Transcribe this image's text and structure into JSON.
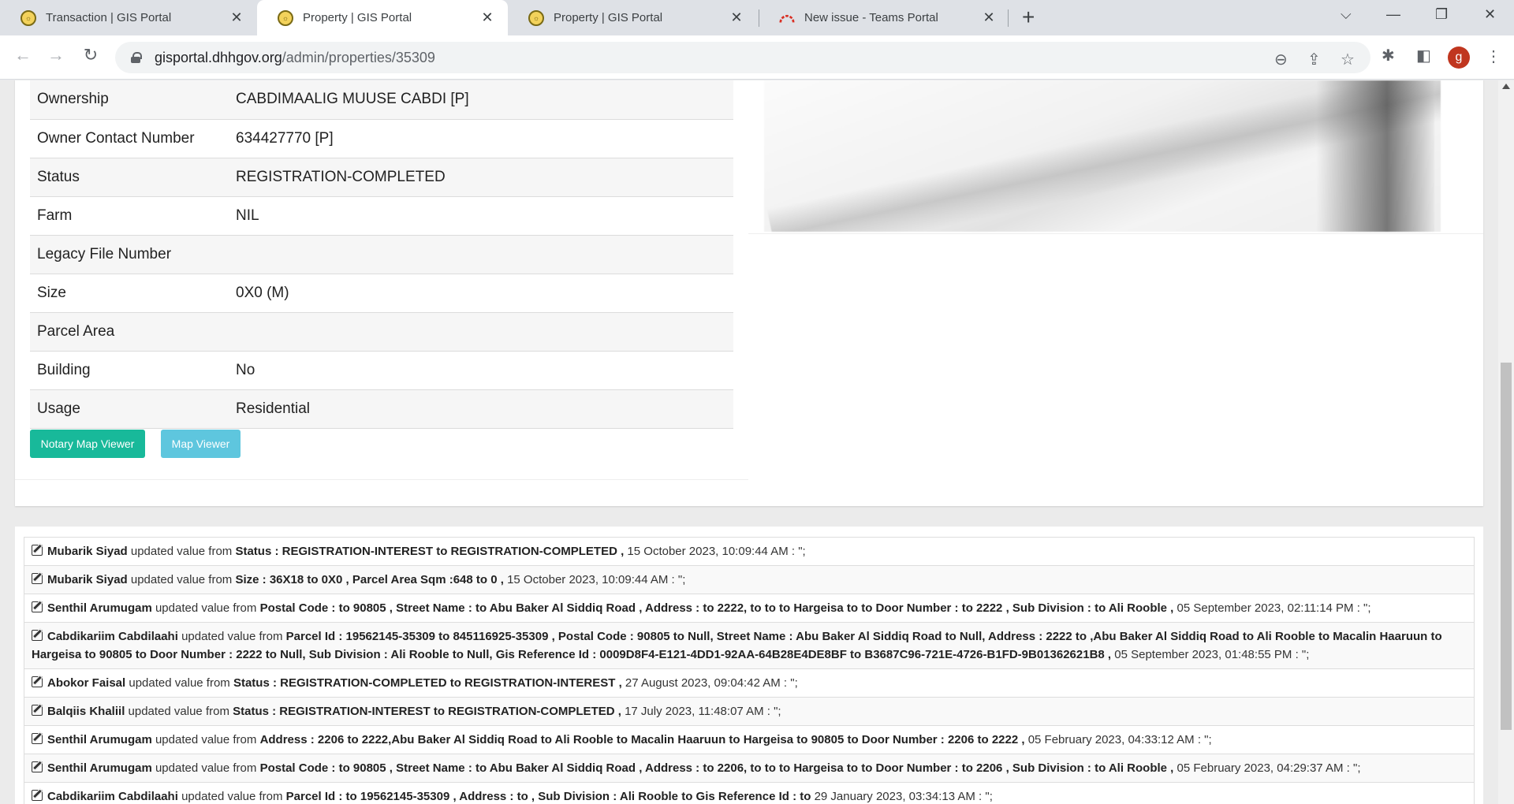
{
  "browser": {
    "tabs": [
      {
        "title": "Transaction | GIS Portal",
        "active": false,
        "favicon": "gis-seal-icon"
      },
      {
        "title": "Property | GIS Portal",
        "active": true,
        "favicon": "gis-seal-icon"
      },
      {
        "title": "Property | GIS Portal",
        "active": false,
        "favicon": "gis-seal-icon"
      },
      {
        "title": "New issue - Teams Portal",
        "active": false,
        "favicon": "teams-logo-icon"
      }
    ],
    "new_tab_glyph": "+",
    "close_glyph": "✕",
    "url_host": "gisportal.dhhgov.org",
    "url_path": "/admin/properties/35309",
    "profile_initial": "g",
    "profile_color": "#c0361f"
  },
  "property": {
    "rows": [
      {
        "label": "Ownership",
        "value": "CABDIMAALIG MUUSE CABDI [P]"
      },
      {
        "label": "Owner Contact Number",
        "value": "634427770 [P]"
      },
      {
        "label": "Status",
        "value": "REGISTRATION-COMPLETED"
      },
      {
        "label": "Farm",
        "value": "NIL"
      },
      {
        "label": "Legacy File Number",
        "value": ""
      },
      {
        "label": "Size",
        "value": "0X0 (M)"
      },
      {
        "label": "Parcel Area",
        "value": ""
      },
      {
        "label": "Building",
        "value": "No"
      },
      {
        "label": "Usage",
        "value": "Residential"
      }
    ],
    "buttons": {
      "notary_map_viewer": "Notary Map Viewer",
      "map_viewer": "Map Viewer"
    },
    "colors": {
      "notary_button": "#18b99a",
      "map_button": "#5ec6de"
    }
  },
  "history": [
    {
      "user": "Mubarik Siyad",
      "verb": "updated value from",
      "change": "Status : REGISTRATION-INTEREST to REGISTRATION-COMPLETED ,",
      "time": "15 October 2023, 10:09:44 AM : \";"
    },
    {
      "user": "Mubarik Siyad",
      "verb": "updated value from",
      "change": "Size : 36X18 to 0X0 , Parcel Area Sqm :648 to 0 ,",
      "time": "15 October 2023, 10:09:44 AM : \";"
    },
    {
      "user": "Senthil Arumugam",
      "verb": "updated value from",
      "change": "Postal Code : to 90805 , Street Name : to Abu Baker Al Siddiq Road , Address : to 2222, to to to Hargeisa to to Door Number : to 2222 , Sub Division : to Ali Rooble ,",
      "time": "05 September 2023, 02:11:14 PM : \";"
    },
    {
      "user": "Cabdikariim Cabdilaahi",
      "verb": "updated value from",
      "change": "Parcel Id : 19562145-35309 to 845116925-35309 , Postal Code : 90805 to Null, Street Name : Abu Baker Al Siddiq Road to Null, Address : 2222 to ,Abu Baker Al Siddiq Road to Ali Rooble to Macalin Haaruun to Hargeisa to 90805 to Door Number : 2222 to Null, Sub Division : Ali Rooble to Null, Gis Reference Id : 0009D8F4-E121-4DD1-92AA-64B28E4DE8BF to B3687C96-721E-4726-B1FD-9B01362621B8 ,",
      "time": "05 September 2023, 01:48:55 PM : \";"
    },
    {
      "user": "Abokor Faisal",
      "verb": "updated value from",
      "change": "Status : REGISTRATION-COMPLETED to REGISTRATION-INTEREST ,",
      "time": "27 August 2023, 09:04:42 AM : \";"
    },
    {
      "user": "Balqiis Khaliil",
      "verb": "updated value from",
      "change": "Status : REGISTRATION-INTEREST to REGISTRATION-COMPLETED ,",
      "time": "17 July 2023, 11:48:07 AM : \";"
    },
    {
      "user": "Senthil Arumugam",
      "verb": "updated value from",
      "change": "Address : 2206 to 2222,Abu Baker Al Siddiq Road to Ali Rooble to Macalin Haaruun to Hargeisa to 90805 to Door Number : 2206 to 2222 ,",
      "time": "05 February 2023, 04:33:12 AM : \";"
    },
    {
      "user": "Senthil Arumugam",
      "verb": "updated value from",
      "change": "Postal Code : to 90805 , Street Name : to Abu Baker Al Siddiq Road , Address : to 2206, to to to Hargeisa to to Door Number : to 2206 , Sub Division : to Ali Rooble ,",
      "time": "05 February 2023, 04:29:37 AM : \";"
    },
    {
      "user": "Cabdikariim Cabdilaahi",
      "verb": "updated value from",
      "change": "Parcel Id : to 19562145-35309 , Address : to , Sub Division : Ali Rooble to Gis Reference Id : to",
      "time": "29 January 2023, 03:34:13 AM : \";"
    }
  ]
}
